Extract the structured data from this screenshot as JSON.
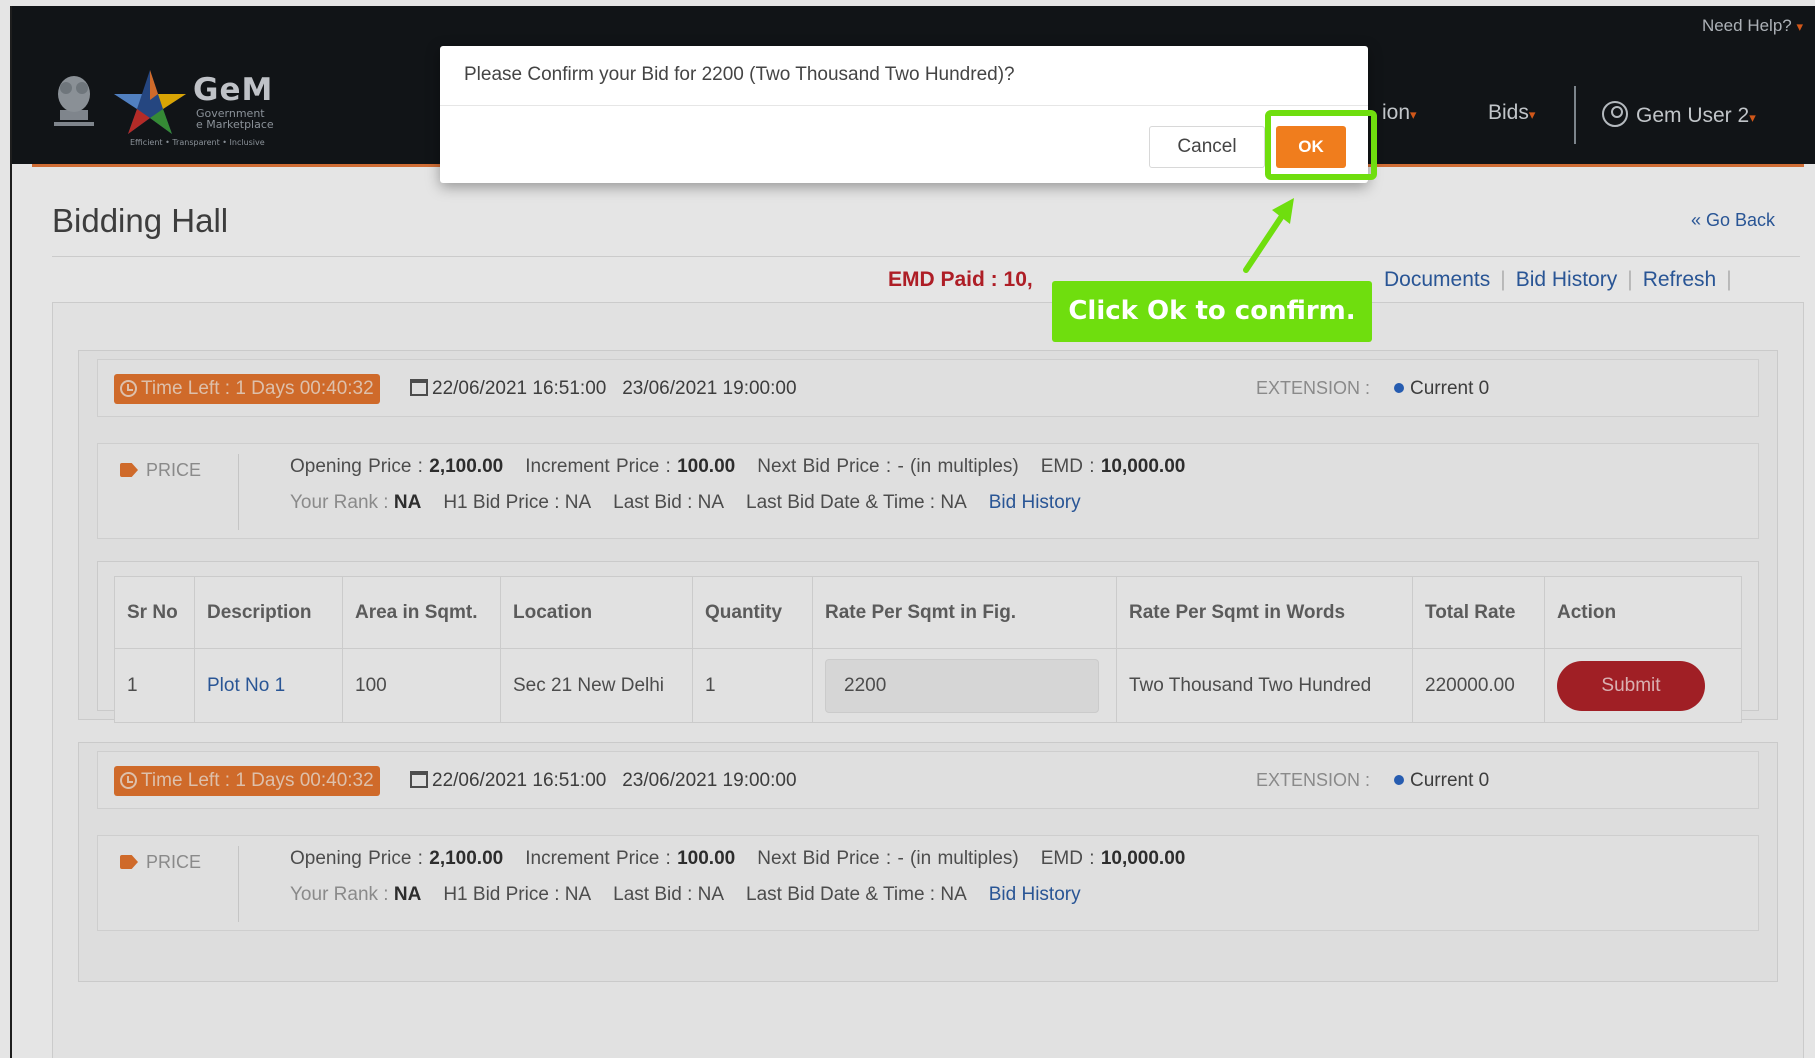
{
  "header": {
    "logo": {
      "name": "GeM",
      "sub_line1": "Government",
      "sub_line2": "e Marketplace",
      "tagline": "Efficient • Transparent • Inclusive"
    },
    "need_help": "Need Help?",
    "nav": {
      "partial_item": "ion",
      "bids": "Bids",
      "user": "Gem User 2"
    },
    "accent_color": "#e9611c"
  },
  "page": {
    "title": "Bidding Hall",
    "go_back": "« Go Back",
    "emd_paid": "EMD Paid : 10,",
    "links": [
      "Documents",
      "Bid History",
      "Refresh"
    ]
  },
  "lots": [
    {
      "time_left": "Time Left : 1 Days 00:40:32",
      "start_date": "22/06/2021 16:51:00",
      "end_date": "23/06/2021 19:00:00",
      "extension_label": "EXTENSION :",
      "extension_current": "Current 0",
      "price_label": "PRICE",
      "opening_price_label": "Opening Price :",
      "opening_price": "2,100.00",
      "increment_price_label": "Increment Price :",
      "increment_price": "100.00",
      "next_bid_price": "Next Bid Price : - (in multiples)",
      "emd_label": "EMD :",
      "emd": "10,000.00",
      "your_rank_label": "Your Rank :",
      "your_rank": "NA",
      "h1_bid_price": "H1 Bid Price : NA",
      "last_bid": "Last Bid : NA",
      "last_bid_date": "Last Bid Date & Time : NA",
      "bid_history": "Bid History",
      "table": {
        "headers": [
          "Sr No",
          "Description",
          "Area in Sqmt.",
          "Location",
          "Quantity",
          "Rate Per Sqmt in Fig.",
          "Rate Per Sqmt in Words",
          "Total Rate",
          "Action"
        ],
        "row": {
          "sr_no": "1",
          "description": "Plot No 1",
          "area": "100",
          "location": "Sec 21 New Delhi",
          "quantity": "1",
          "rate_fig": "2200",
          "rate_words": "Two Thousand Two Hundred",
          "total_rate": "220000.00",
          "action": "Submit"
        }
      }
    },
    {
      "time_left": "Time Left : 1 Days 00:40:32",
      "start_date": "22/06/2021 16:51:00",
      "end_date": "23/06/2021 19:00:00",
      "extension_label": "EXTENSION :",
      "extension_current": "Current 0",
      "price_label": "PRICE",
      "opening_price_label": "Opening Price :",
      "opening_price": "2,100.00",
      "increment_price_label": "Increment Price :",
      "increment_price": "100.00",
      "next_bid_price": "Next Bid Price : - (in multiples)",
      "emd_label": "EMD :",
      "emd": "10,000.00",
      "your_rank_label": "Your Rank :",
      "your_rank": "NA",
      "h1_bid_price": "H1 Bid Price : NA",
      "last_bid": "Last Bid : NA",
      "last_bid_date": "Last Bid Date & Time : NA",
      "bid_history": "Bid History"
    }
  ],
  "modal": {
    "message": "Please Confirm your Bid for 2200 (Two Thousand Two Hundred)?",
    "cancel_label": "Cancel",
    "ok_label": "OK"
  },
  "annotation": {
    "callout": "Click Ok to confirm.",
    "highlight_color": "#6fde0e"
  }
}
